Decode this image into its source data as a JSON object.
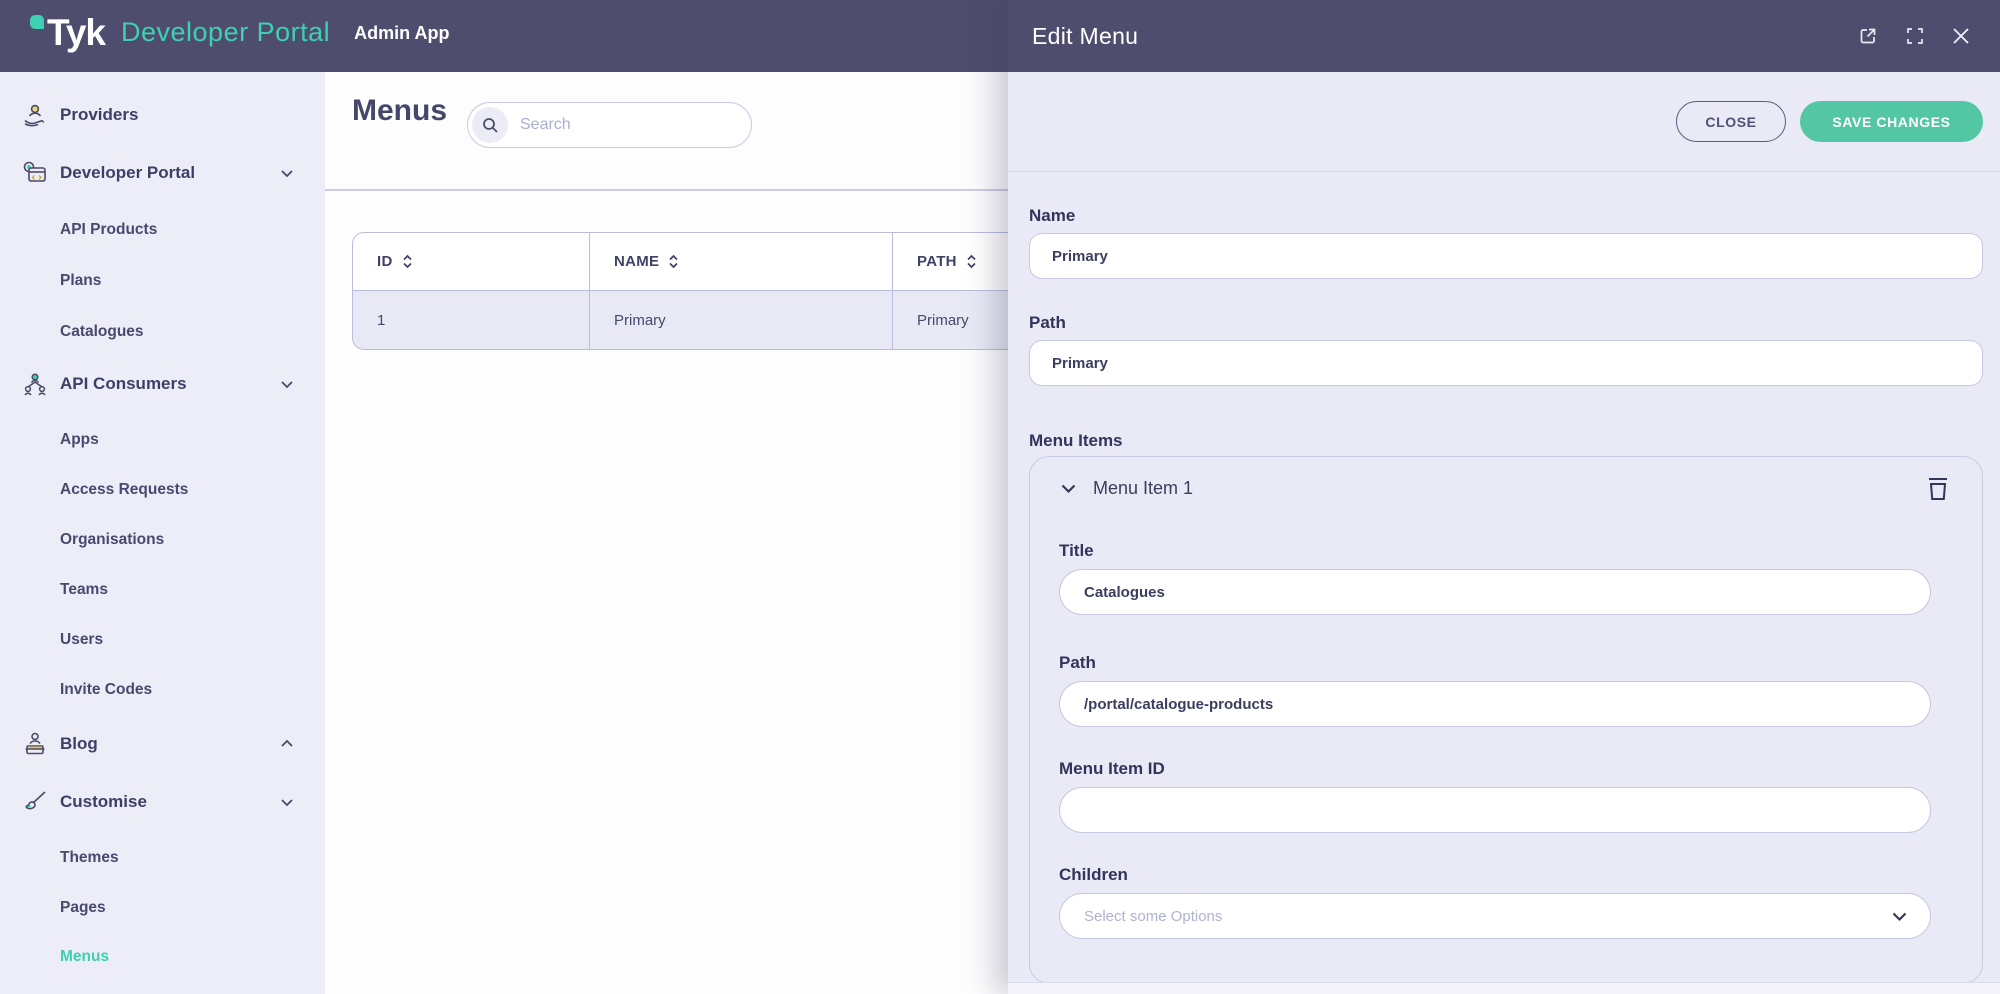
{
  "navbar": {
    "brand": "Tyk",
    "product": "Developer Portal",
    "app": "Admin App"
  },
  "sidebar": {
    "items": [
      {
        "label": "Providers",
        "type": "top",
        "icon": "providers-icon",
        "chevron": "none"
      },
      {
        "label": "Developer Portal",
        "type": "top",
        "icon": "developer-portal-icon",
        "chevron": "down"
      },
      {
        "label": "API Products",
        "type": "sub"
      },
      {
        "label": "Plans",
        "type": "sub"
      },
      {
        "label": "Catalogues",
        "type": "sub"
      },
      {
        "label": "API Consumers",
        "type": "top",
        "icon": "api-consumers-icon",
        "chevron": "down"
      },
      {
        "label": "Apps",
        "type": "sub"
      },
      {
        "label": "Access Requests",
        "type": "sub"
      },
      {
        "label": "Organisations",
        "type": "sub"
      },
      {
        "label": "Teams",
        "type": "sub"
      },
      {
        "label": "Users",
        "type": "sub"
      },
      {
        "label": "Invite Codes",
        "type": "sub"
      },
      {
        "label": "Blog",
        "type": "top",
        "icon": "blog-icon",
        "chevron": "up"
      },
      {
        "label": "Customise",
        "type": "top",
        "icon": "customise-icon",
        "chevron": "down"
      },
      {
        "label": "Themes",
        "type": "sub"
      },
      {
        "label": "Pages",
        "type": "sub"
      },
      {
        "label": "Menus",
        "type": "sub",
        "active": true
      }
    ]
  },
  "page": {
    "title": "Menus",
    "search_placeholder": "Search"
  },
  "table": {
    "columns": [
      "ID",
      "NAME",
      "PATH"
    ],
    "rows": [
      [
        "1",
        "Primary",
        "Primary"
      ]
    ]
  },
  "drawer": {
    "title": "Edit Menu",
    "close_label": "CLOSE",
    "save_label": "SAVE CHANGES",
    "fields": {
      "name_label": "Name",
      "name_value": "Primary",
      "path_label": "Path",
      "path_value": "Primary",
      "menu_items_label": "Menu Items"
    },
    "menu_item": {
      "header": "Menu Item 1",
      "title_label": "Title",
      "title_value": "Catalogues",
      "path_label": "Path",
      "path_value": "/portal/catalogue-products",
      "id_label": "Menu Item ID",
      "id_value": "",
      "children_label": "Children",
      "children_placeholder": "Select some Options"
    },
    "icons": [
      "external-link-icon",
      "fullscreen-icon",
      "close-icon",
      "trash-icon",
      "chevron-down-icon"
    ]
  },
  "colors": {
    "navbar": "#4f4d6d",
    "accent_teal": "#3ed0b2",
    "save_button": "#53c7a4",
    "sidebar_bg": "#ededf8",
    "drawer_bg": "#e9eaf6",
    "row_bg": "#e8e9f5",
    "border": "#c6c8e2",
    "text_dark": "#3d4066"
  }
}
